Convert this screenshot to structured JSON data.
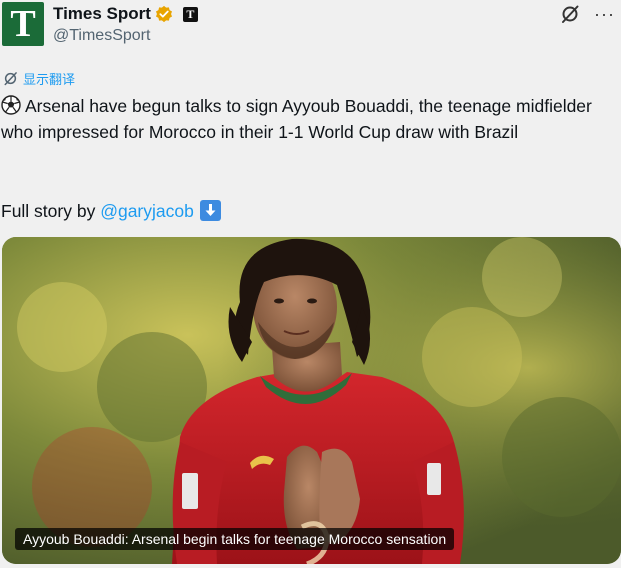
{
  "account": {
    "avatar_letter": "T",
    "display_name": "Times Sport",
    "handle": "@TimesSport",
    "publisher_logo": "T",
    "avatar_color": "#1b6b38",
    "verified_color": "#e8a400"
  },
  "top_actions": {
    "grok_icon": "grok-icon",
    "more_label": "···"
  },
  "translate": {
    "icon": "translate-icon",
    "label": "显示翻译"
  },
  "tweet": {
    "emoji": "soccer-ball",
    "text": "Arsenal have begun talks to sign Ayyoub Bouaddi, the teenage midfielder who impressed for Morocco in their 1-1 World Cup draw with Brazil",
    "story_prefix": "Full story by",
    "mention": "@garyjacob",
    "trailing_emoji": "down-arrow-button",
    "link_color": "#1d9bf0"
  },
  "media": {
    "caption": "Ayyoub Bouaddi: Arsenal begin talks for teenage Morocco sensation"
  }
}
